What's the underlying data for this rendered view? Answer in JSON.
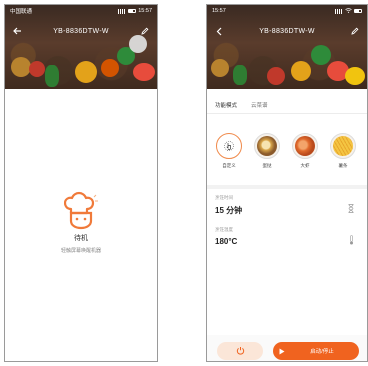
{
  "left_phone": {
    "status_bar": {
      "carrier": "中国联通",
      "time": "15:57"
    },
    "title": "YB-8836DTW-W",
    "standby": {
      "state_label": "待机",
      "hint": "轻触屏幕唤醒机器"
    }
  },
  "right_phone": {
    "status_bar": {
      "time": "15:57"
    },
    "title": "YB-8836DTW-W",
    "tabs": [
      {
        "label": "功能模式",
        "active": true
      },
      {
        "label": "云菜谱",
        "active": false
      }
    ],
    "modes": [
      {
        "label": "自定义",
        "icon": "hand-tap-icon",
        "selected": true
      },
      {
        "label": "蛋挞"
      },
      {
        "label": "大虾"
      },
      {
        "label": "薯条"
      }
    ],
    "params": {
      "time": {
        "label": "烹饪时间",
        "value": "15 分钟",
        "icon": "hourglass-icon"
      },
      "temp": {
        "label": "烹饪温度",
        "value": "180°C",
        "icon": "thermometer-icon"
      }
    },
    "buttons": {
      "power_icon": "power-icon",
      "start_label": "启动/停止"
    }
  },
  "colors": {
    "accent": "#f0631f",
    "accent_light": "#fbe6d8",
    "chef_icon": "#f07a3a"
  }
}
